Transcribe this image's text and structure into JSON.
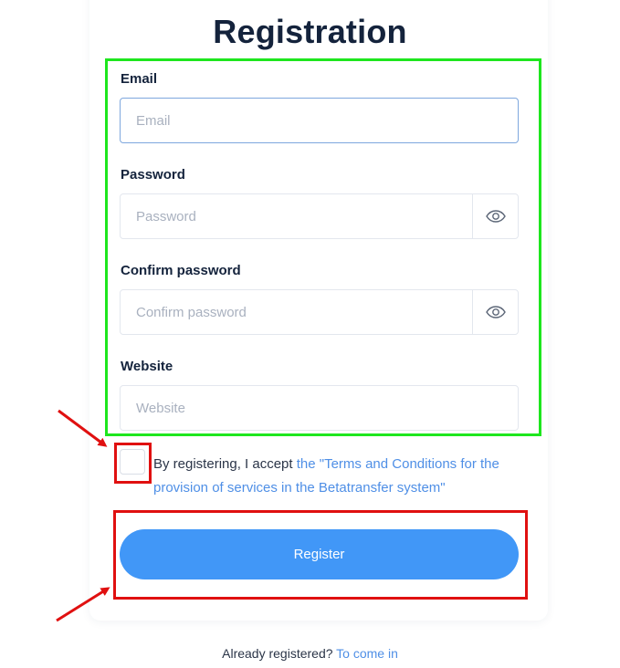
{
  "title": "Registration",
  "form": {
    "email": {
      "label": "Email",
      "placeholder": "Email",
      "value": ""
    },
    "password": {
      "label": "Password",
      "placeholder": "Password",
      "value": "",
      "toggle_icon": "eye-icon"
    },
    "confirm_password": {
      "label": "Confirm password",
      "placeholder": "Confirm password",
      "value": "",
      "toggle_icon": "eye-icon"
    },
    "website": {
      "label": "Website",
      "placeholder": "Website",
      "value": ""
    }
  },
  "terms": {
    "checked": false,
    "prefix": "By registering, I accept ",
    "link_text": "the \"Terms and Conditions for the provision of services in the Betatransfer system\""
  },
  "register_button": {
    "label": "Register"
  },
  "footer": {
    "prompt": "Already registered? ",
    "link_text": "To come in"
  },
  "annotations": {
    "green_highlight_color": "#1ee61e",
    "red_highlight_color": "#e01010",
    "arrow_color": "#e01010"
  },
  "colors": {
    "accent": "#4197f7",
    "link": "#4f8fe6",
    "heading": "#14233c"
  }
}
